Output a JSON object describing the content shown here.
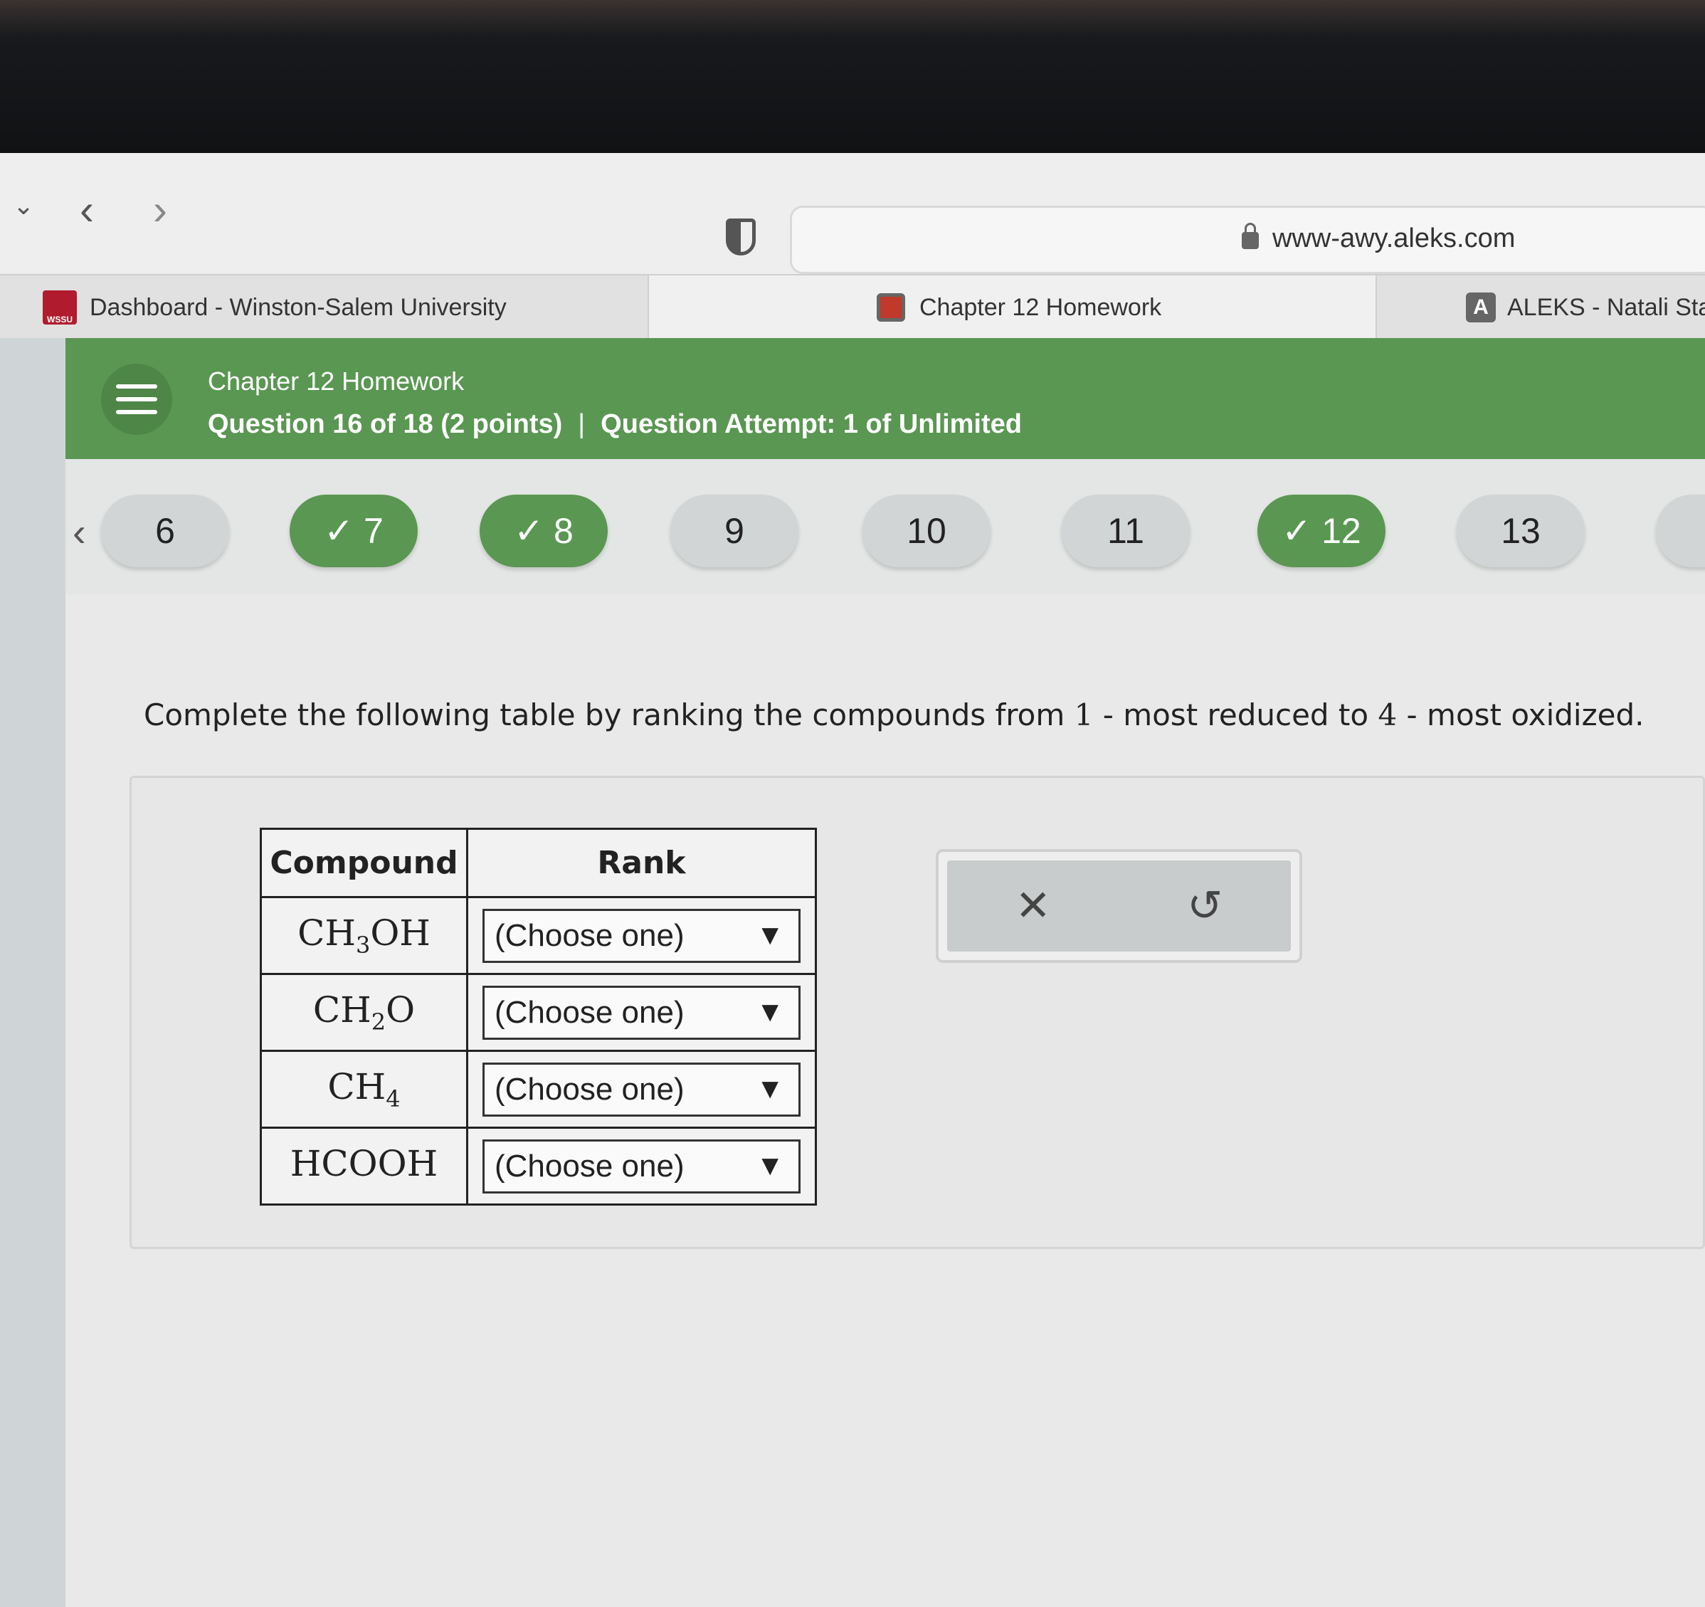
{
  "browser": {
    "url": "www-awy.aleks.com",
    "tabs": [
      {
        "label": "Dashboard - Winston-Salem University",
        "favicon": "wssu-logo-icon"
      },
      {
        "label": "Chapter 12 Homework",
        "favicon": "homework-icon"
      },
      {
        "label": "ALEKS - Natali Star",
        "favicon": "aleks-a-icon"
      }
    ]
  },
  "header": {
    "title": "Chapter 12 Homework",
    "question_info": "Question 16 of 18 (2 points)",
    "separator": "|",
    "attempt_info": "Question Attempt: 1 of Unlimited"
  },
  "qnav": {
    "pills": [
      {
        "label": "6",
        "done": false
      },
      {
        "label": "7",
        "done": true
      },
      {
        "label": "8",
        "done": true
      },
      {
        "label": "9",
        "done": false
      },
      {
        "label": "10",
        "done": false
      },
      {
        "label": "11",
        "done": false
      },
      {
        "label": "12",
        "done": true
      },
      {
        "label": "13",
        "done": false
      }
    ]
  },
  "question": {
    "text_before": "Complete the following table by ranking the compounds from ",
    "num1": "1",
    "text_mid": " - most reduced to ",
    "num2": "4",
    "text_after": " - most oxidized."
  },
  "table": {
    "headers": [
      "Compound",
      "Rank"
    ],
    "rows": [
      {
        "compound": [
          "CH",
          "3",
          "OH"
        ],
        "rank": "(Choose one)"
      },
      {
        "compound": [
          "CH",
          "2",
          "O"
        ],
        "rank": "(Choose one)"
      },
      {
        "compound": [
          "CH",
          "4",
          ""
        ],
        "rank": "(Choose one)"
      },
      {
        "compound": [
          "HCOOH",
          "",
          ""
        ],
        "rank": "(Choose one)"
      }
    ]
  },
  "colors": {
    "header_green": "#5a9752",
    "completed_green": "#5a9752"
  }
}
